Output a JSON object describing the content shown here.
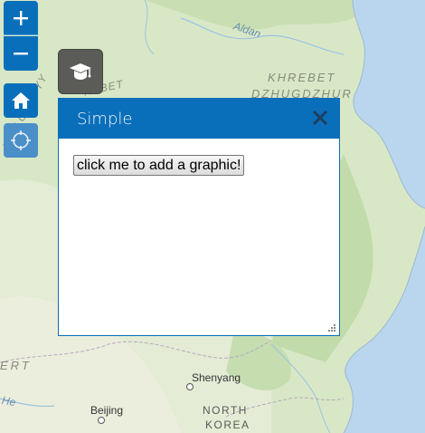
{
  "map": {
    "labels": {
      "aldan": "Aldan",
      "khrebet": "KHREBET",
      "dzhugdzhur": "DZHUGDZHUR",
      "yablonovyy": "YABLONOVYY",
      "rebet": "REBET",
      "ert": "ERT",
      "he": "He",
      "shenyang": "Shenyang",
      "beijing": "Beijing",
      "north": "NORTH",
      "korea": "KOREA"
    },
    "colors": {
      "land": "#d7e7c4",
      "forest": "#c4dcae",
      "water": "#b9d6ee"
    }
  },
  "controls": {
    "zoom_in_icon": "plus-icon",
    "zoom_out_icon": "minus-icon",
    "home_icon": "home-icon",
    "locate_icon": "locate-icon",
    "edu_icon": "graduation-cap-icon"
  },
  "popup": {
    "title": "Simple",
    "close_icon": "close-icon",
    "button_label": "click me to add a graphic!",
    "accent": "#0a6fba"
  }
}
